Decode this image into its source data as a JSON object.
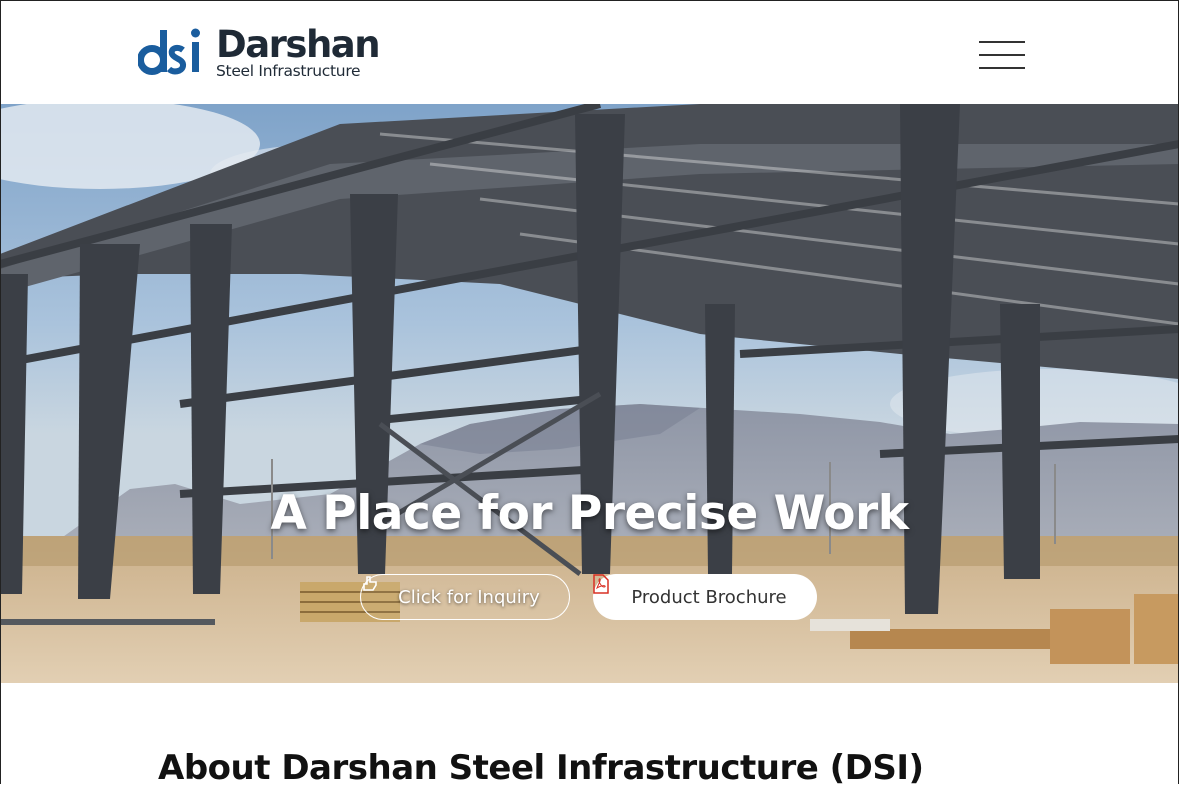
{
  "header": {
    "logo_name": "Darshan",
    "logo_tagline": "Steel Infrastructure",
    "logo_mark_text": "dsi",
    "menu_icon": "hamburger-menu-icon"
  },
  "hero": {
    "title": "A Place for Precise Work",
    "inquiry_button": "Click for Inquiry",
    "inquiry_icon": "hand-pointer-icon",
    "brochure_button": "Product Brochure",
    "brochure_icon": "pdf-file-icon"
  },
  "about": {
    "title_prefix": "About",
    "title_bold": "Darshan Steel Infrastructure (DSI)"
  },
  "colors": {
    "brand_blue": "#1a5d9e",
    "text_dark": "#1f2a36",
    "pdf_red": "#d93025"
  }
}
